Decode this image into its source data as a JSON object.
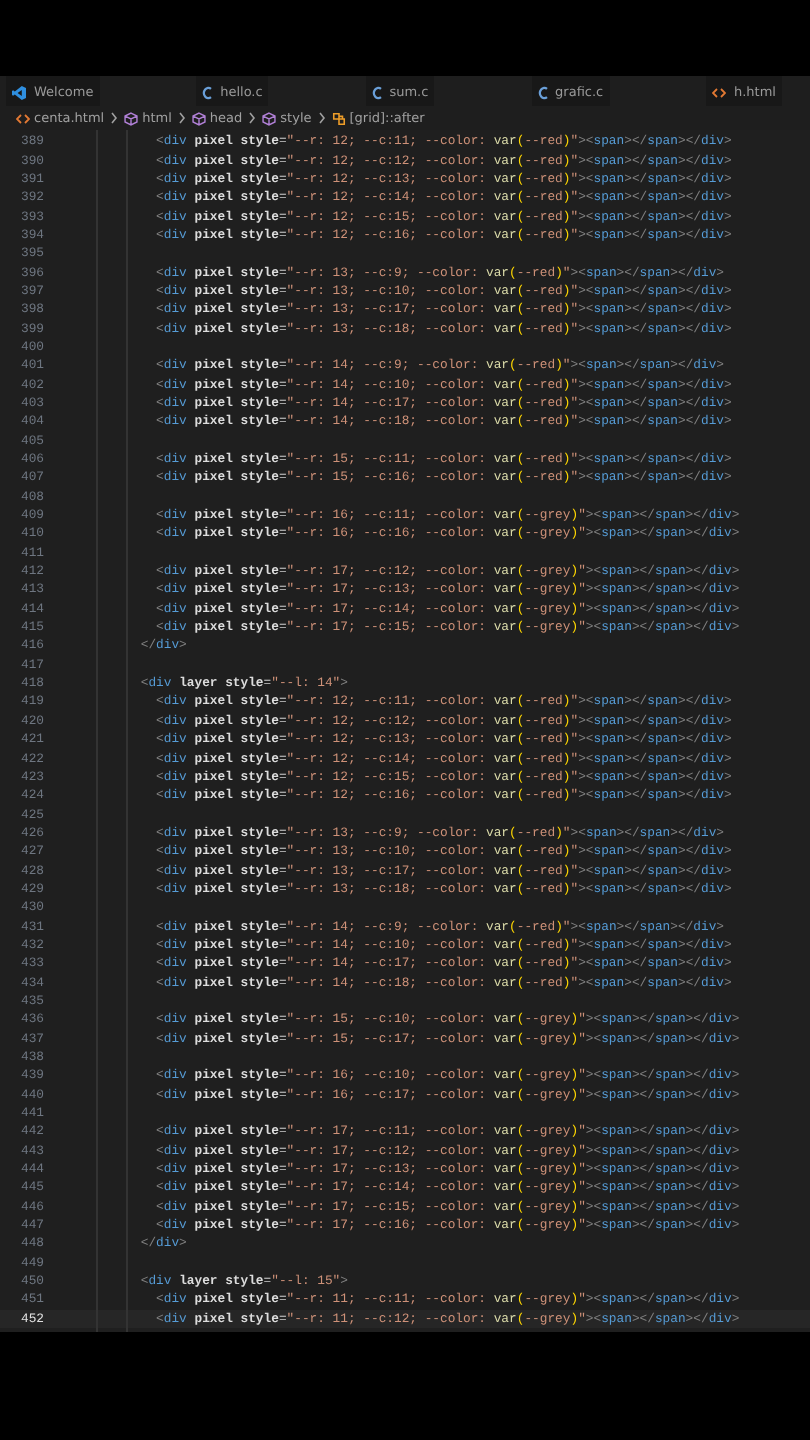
{
  "tabs": [
    {
      "label": "Welcome",
      "kind": "vscode",
      "selected": false
    },
    {
      "label": "hello.c",
      "kind": "c",
      "selected": false
    },
    {
      "label": "sum.c",
      "kind": "c",
      "selected": false
    },
    {
      "label": "grafic.c",
      "kind": "c",
      "selected": false
    },
    {
      "label": "h.html",
      "kind": "html",
      "selected": false
    }
  ],
  "breadcrumb": [
    {
      "label": "centa.html",
      "kind": "file"
    },
    {
      "label": "html",
      "kind": "element"
    },
    {
      "label": "head",
      "kind": "element"
    },
    {
      "label": "style",
      "kind": "element"
    },
    {
      "label": "[grid]::after",
      "kind": "selector"
    }
  ],
  "lines": [
    {
      "n": "389",
      "text": "            <div pixel style=\"--r: 12; --c:11; --color: var(--red)\"><span></span></div>",
      "selected": false
    },
    {
      "n": "390",
      "text": "            <div pixel style=\"--r: 12; --c:12; --color: var(--red)\"><span></span></div>",
      "selected": false
    },
    {
      "n": "391",
      "text": "            <div pixel style=\"--r: 12; --c:13; --color: var(--red)\"><span></span></div>",
      "selected": false
    },
    {
      "n": "392",
      "text": "            <div pixel style=\"--r: 12; --c:14; --color: var(--red)\"><span></span></div>",
      "selected": false
    },
    {
      "n": "393",
      "text": "            <div pixel style=\"--r: 12; --c:15; --color: var(--red)\"><span></span></div>",
      "selected": false
    },
    {
      "n": "394",
      "text": "            <div pixel style=\"--r: 12; --c:16; --color: var(--red)\"><span></span></div>",
      "selected": false
    },
    {
      "n": "395",
      "selected": false
    },
    {
      "n": "396",
      "text": "            <div pixel style=\"--r: 13; --c:9; --color: var(--red)\"><span></span></div>",
      "selected": false
    },
    {
      "n": "397",
      "text": "            <div pixel style=\"--r: 13; --c:10; --color: var(--red)\"><span></span></div>",
      "selected": false
    },
    {
      "n": "398",
      "text": "            <div pixel style=\"--r: 13; --c:17; --color: var(--red)\"><span></span></div>",
      "selected": false
    },
    {
      "n": "399",
      "text": "            <div pixel style=\"--r: 13; --c:18; --color: var(--red)\"><span></span></div>",
      "selected": false
    },
    {
      "n": "400",
      "selected": false
    },
    {
      "n": "401",
      "text": "            <div pixel style=\"--r: 14; --c:9; --color: var(--red)\"><span></span></div>",
      "selected": false
    },
    {
      "n": "402",
      "text": "            <div pixel style=\"--r: 14; --c:10; --color: var(--red)\"><span></span></div>",
      "selected": false
    },
    {
      "n": "403",
      "text": "            <div pixel style=\"--r: 14; --c:17; --color: var(--red)\"><span></span></div>",
      "selected": false
    },
    {
      "n": "404",
      "text": "            <div pixel style=\"--r: 14; --c:18; --color: var(--red)\"><span></span></div>",
      "selected": false
    },
    {
      "n": "405",
      "selected": false
    },
    {
      "n": "406",
      "text": "            <div pixel style=\"--r: 15; --c:11; --color: var(--red)\"><span></span></div>",
      "selected": false
    },
    {
      "n": "407",
      "text": "            <div pixel style=\"--r: 15; --c:16; --color: var(--red)\"><span></span></div>",
      "selected": false
    },
    {
      "n": "408",
      "selected": false
    },
    {
      "n": "409",
      "text": "            <div pixel style=\"--r: 16; --c:11; --color: var(--grey)\"><span></span></div>",
      "selected": false
    },
    {
      "n": "410",
      "text": "            <div pixel style=\"--r: 16; --c:16; --color: var(--grey)\"><span></span></div>",
      "selected": false
    },
    {
      "n": "411",
      "selected": false
    },
    {
      "n": "412",
      "text": "            <div pixel style=\"--r: 17; --c:12; --color: var(--grey)\"><span></span></div>",
      "selected": false
    },
    {
      "n": "413",
      "text": "            <div pixel style=\"--r: 17; --c:13; --color: var(--grey)\"><span></span></div>",
      "selected": false
    },
    {
      "n": "414",
      "text": "            <div pixel style=\"--r: 17; --c:14; --color: var(--grey)\"><span></span></div>",
      "selected": false
    },
    {
      "n": "415",
      "text": "            <div pixel style=\"--r: 17; --c:15; --color: var(--grey)\"><span></span></div>",
      "selected": false
    },
    {
      "n": "416",
      "text": "          </div>",
      "selected": false
    },
    {
      "n": "417",
      "selected": false
    },
    {
      "n": "418",
      "text": "          <div layer style=\"--l: 14\">",
      "selected": false
    },
    {
      "n": "419",
      "text": "            <div pixel style=\"--r: 12; --c:11; --color: var(--red)\"><span></span></div>",
      "selected": false
    },
    {
      "n": "420",
      "text": "            <div pixel style=\"--r: 12; --c:12; --color: var(--red)\"><span></span></div>",
      "selected": false
    },
    {
      "n": "421",
      "text": "            <div pixel style=\"--r: 12; --c:13; --color: var(--red)\"><span></span></div>",
      "selected": false
    },
    {
      "n": "422",
      "text": "            <div pixel style=\"--r: 12; --c:14; --color: var(--red)\"><span></span></div>",
      "selected": false
    },
    {
      "n": "423",
      "text": "            <div pixel style=\"--r: 12; --c:15; --color: var(--red)\"><span></span></div>",
      "selected": false
    },
    {
      "n": "424",
      "text": "            <div pixel style=\"--r: 12; --c:16; --color: var(--red)\"><span></span></div>",
      "selected": false
    },
    {
      "n": "425",
      "selected": false
    },
    {
      "n": "426",
      "text": "            <div pixel style=\"--r: 13; --c:9; --color: var(--red)\"><span></span></div>",
      "selected": false
    },
    {
      "n": "427",
      "text": "            <div pixel style=\"--r: 13; --c:10; --color: var(--red)\"><span></span></div>",
      "selected": false
    },
    {
      "n": "428",
      "text": "            <div pixel style=\"--r: 13; --c:17; --color: var(--red)\"><span></span></div>",
      "selected": false
    },
    {
      "n": "429",
      "text": "            <div pixel style=\"--r: 13; --c:18; --color: var(--red)\"><span></span></div>",
      "selected": false
    },
    {
      "n": "430",
      "selected": false
    },
    {
      "n": "431",
      "text": "            <div pixel style=\"--r: 14; --c:9; --color: var(--red)\"><span></span></div>",
      "selected": false
    },
    {
      "n": "432",
      "text": "            <div pixel style=\"--r: 14; --c:10; --color: var(--red)\"><span></span></div>",
      "selected": false
    },
    {
      "n": "433",
      "text": "            <div pixel style=\"--r: 14; --c:17; --color: var(--red)\"><span></span></div>",
      "selected": false
    },
    {
      "n": "434",
      "text": "            <div pixel style=\"--r: 14; --c:18; --color: var(--red)\"><span></span></div>",
      "selected": false
    },
    {
      "n": "435",
      "selected": false
    },
    {
      "n": "436",
      "text": "            <div pixel style=\"--r: 15; --c:10; --color: var(--grey)\"><span></span></div>",
      "selected": false
    },
    {
      "n": "437",
      "text": "            <div pixel style=\"--r: 15; --c:17; --color: var(--grey)\"><span></span></div>",
      "selected": false
    },
    {
      "n": "438",
      "selected": false
    },
    {
      "n": "439",
      "text": "            <div pixel style=\"--r: 16; --c:10; --color: var(--grey)\"><span></span></div>",
      "selected": false
    },
    {
      "n": "440",
      "text": "            <div pixel style=\"--r: 16; --c:17; --color: var(--grey)\"><span></span></div>",
      "selected": false
    },
    {
      "n": "441",
      "selected": false
    },
    {
      "n": "442",
      "text": "            <div pixel style=\"--r: 17; --c:11; --color: var(--grey)\"><span></span></div>",
      "selected": false
    },
    {
      "n": "443",
      "text": "            <div pixel style=\"--r: 17; --c:12; --color: var(--grey)\"><span></span></div>",
      "selected": false
    },
    {
      "n": "444",
      "text": "            <div pixel style=\"--r: 17; --c:13; --color: var(--grey)\"><span></span></div>",
      "selected": false
    },
    {
      "n": "445",
      "text": "            <div pixel style=\"--r: 17; --c:14; --color: var(--grey)\"><span></span></div>",
      "selected": false
    },
    {
      "n": "446",
      "text": "            <div pixel style=\"--r: 17; --c:15; --color: var(--grey)\"><span></span></div>",
      "selected": false
    },
    {
      "n": "447",
      "text": "            <div pixel style=\"--r: 17; --c:16; --color: var(--grey)\"><span></span></div>",
      "selected": false
    },
    {
      "n": "448",
      "text": "          </div>",
      "selected": false
    },
    {
      "n": "449",
      "selected": false
    },
    {
      "n": "450",
      "text": "          <div layer style=\"--l: 15\">",
      "selected": false
    },
    {
      "n": "451",
      "text": "            <div pixel style=\"--r: 11; --c:11; --color: var(--grey)\"><span></span></div>",
      "selected": false
    },
    {
      "n": "452",
      "text": "            <div pixel style=\"--r: 11; --c:12; --color: var(--grey)\"><span></span></div>",
      "selected": true
    }
  ]
}
